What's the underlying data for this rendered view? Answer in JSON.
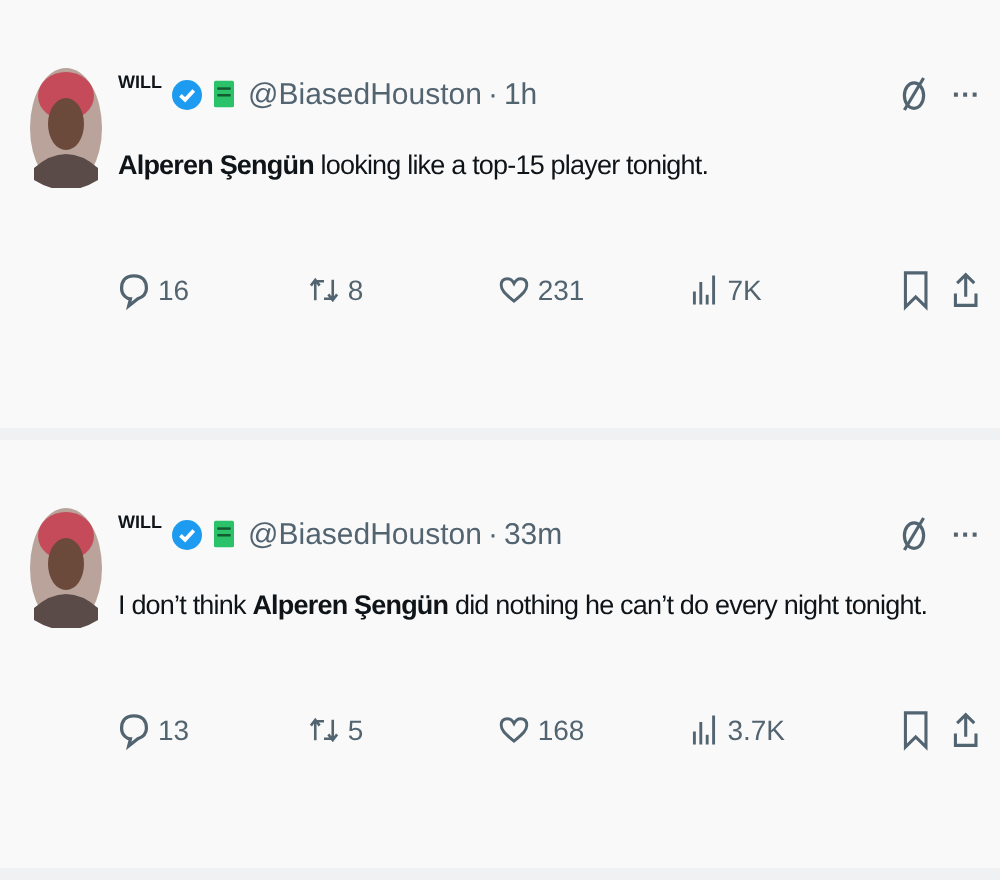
{
  "posts": [
    {
      "display_name": "WILL",
      "verified": true,
      "handle": "@BiasedHouston",
      "separator": "·",
      "time": "1h",
      "text": "**Alperen Şengün** looking like a top-15 player tonight.",
      "replies": "16",
      "reposts": "8",
      "likes": "231",
      "views": "7K",
      "more": "···"
    },
    {
      "display_name": "WILL",
      "verified": true,
      "handle": "@BiasedHouston",
      "separator": "·",
      "time": "33m",
      "text": "I don’t think **Alperen Şengün** did nothing he can’t do every night tonight.",
      "replies": "13",
      "reposts": "5",
      "likes": "168",
      "views": "3.7K",
      "more": "···"
    }
  ]
}
